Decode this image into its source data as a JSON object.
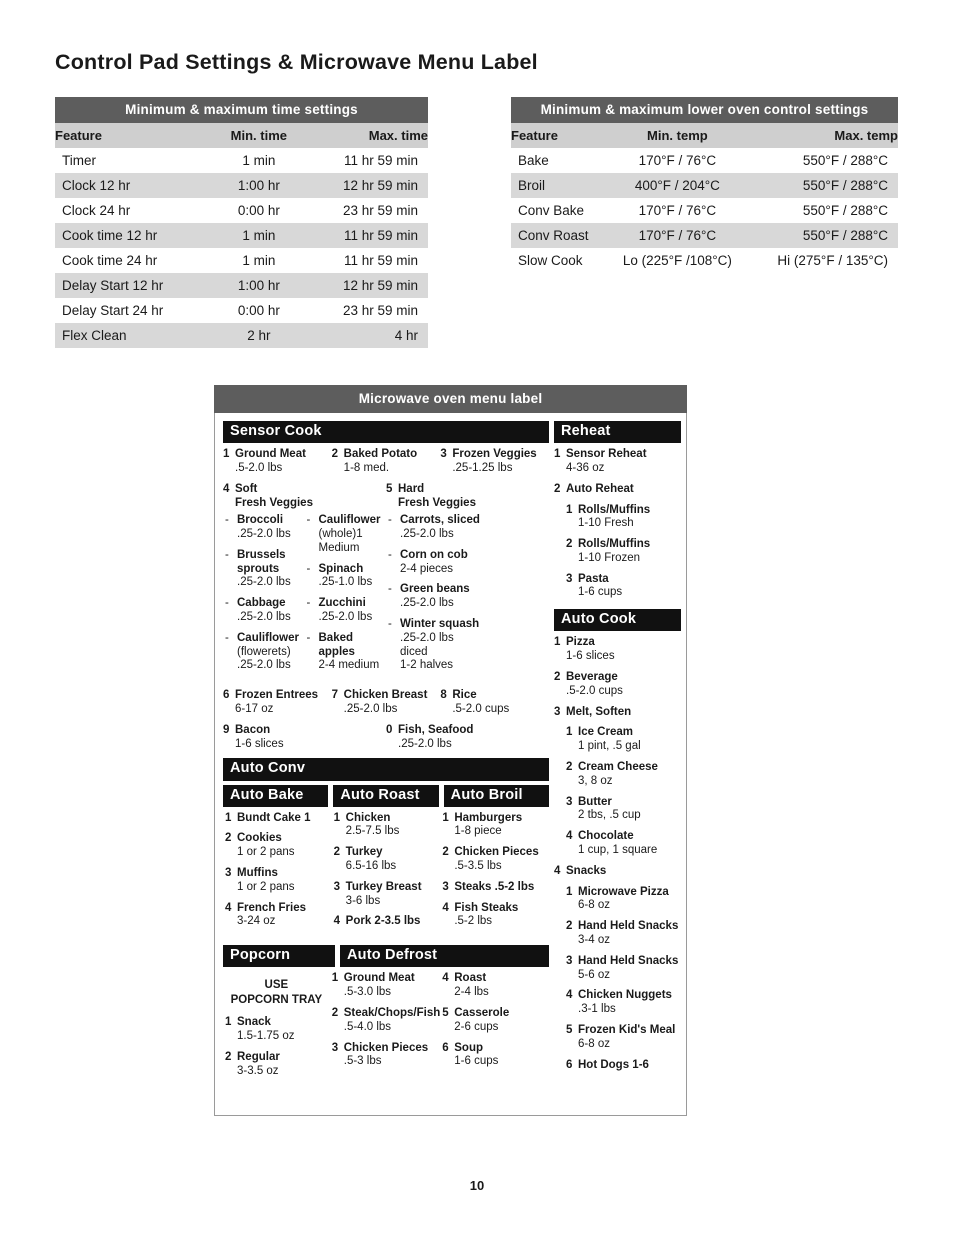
{
  "page_title": "Control Pad Settings & Microwave Menu Label",
  "page_number": "10",
  "time_table": {
    "title": "Minimum & maximum time settings",
    "columns": [
      "Feature",
      "Min. time",
      "Max. time"
    ],
    "rows": [
      [
        "Timer",
        "1 min",
        "11 hr 59 min"
      ],
      [
        "Clock 12 hr",
        "1:00 hr",
        "12 hr 59 min"
      ],
      [
        "Clock 24 hr",
        "0:00 hr",
        "23 hr 59 min"
      ],
      [
        "Cook time 12 hr",
        "1 min",
        "11 hr 59 min"
      ],
      [
        "Cook time 24 hr",
        "1 min",
        "11 hr 59 min"
      ],
      [
        "Delay Start 12 hr",
        "1:00 hr",
        "12 hr 59 min"
      ],
      [
        "Delay Start 24 hr",
        "0:00 hr",
        "23 hr 59 min"
      ],
      [
        "Flex Clean",
        "2 hr",
        "4 hr"
      ]
    ]
  },
  "oven_table": {
    "title": "Minimum & maximum lower oven control settings",
    "columns": [
      "Feature",
      "Min. temp",
      "Max. temp"
    ],
    "rows": [
      [
        "Bake",
        "170°F / 76°C",
        "550°F / 288°C"
      ],
      [
        "Broil",
        "400°F / 204°C",
        "550°F / 288°C"
      ],
      [
        "Conv Bake",
        "170°F / 76°C",
        "550°F / 288°C"
      ],
      [
        "Conv Roast",
        "170°F / 76°C",
        "550°F / 288°C"
      ],
      [
        "Slow Cook",
        "Lo (225°F /108°C)",
        "Hi (275°F / 135°C)"
      ]
    ]
  },
  "menu_label": {
    "title": "Microwave oven menu label",
    "sensor_cook": {
      "bar": "Sensor Cook",
      "row1": [
        {
          "num": "1",
          "name": "Ground Meat",
          "qty": ".5-2.0 lbs"
        },
        {
          "num": "2",
          "name": "Baked Potato",
          "qty": "1-8 med."
        },
        {
          "num": "3",
          "name": "Frozen Veggies",
          "qty": ".25-1.25 lbs"
        }
      ],
      "soft": {
        "num": "4",
        "line1": "Soft",
        "line2": "Fresh Veggies",
        "col1": [
          {
            "name": "Broccoli",
            "qty": ".25-2.0 lbs"
          },
          {
            "name": "Brussels sprouts",
            "qty": ".25-2.0 lbs"
          },
          {
            "name": "Cabbage",
            "qty": ".25-2.0 lbs"
          },
          {
            "name": "Cauliflower",
            "qty": "(flowerets)\n.25-2.0 lbs"
          }
        ],
        "col2": [
          {
            "name": "Cauliflower",
            "qty": "(whole)1 Medium"
          },
          {
            "name": "Spinach",
            "qty": ".25-1.0 lbs"
          },
          {
            "name": "Zucchini",
            "qty": ".25-2.0 lbs"
          },
          {
            "name": "Baked apples",
            "qty": "2-4 medium"
          }
        ]
      },
      "hard": {
        "num": "5",
        "line1": "Hard",
        "line2": "Fresh Veggies",
        "col1": [
          {
            "name": "Carrots, sliced",
            "qty": ".25-2.0 lbs"
          },
          {
            "name": "Corn on cob",
            "qty": "2-4 pieces"
          },
          {
            "name": "Green beans",
            "qty": ".25-2.0 lbs"
          },
          {
            "name": "Winter squash",
            "qty": ".25-2.0 lbs\ndiced\n1-2 halves"
          }
        ]
      },
      "row2": [
        {
          "num": "6",
          "name": "Frozen Entrees",
          "qty": "6-17 oz"
        },
        {
          "num": "7",
          "name": "Chicken Breast",
          "qty": ".25-2.0 lbs"
        },
        {
          "num": "8",
          "name": "Rice",
          "qty": ".5-2.0 cups"
        }
      ],
      "row3": [
        {
          "num": "9",
          "name": "Bacon",
          "qty": "1-6 slices"
        },
        {
          "num": "0",
          "name": "Fish, Seafood",
          "qty": ".25-2.0 lbs"
        }
      ]
    },
    "auto_conv": {
      "bar": "Auto Conv",
      "auto_bake": {
        "bar": "Auto Bake",
        "items": [
          {
            "num": "1",
            "name": "Bundt Cake 1",
            "qty": ""
          },
          {
            "num": "2",
            "name": "Cookies",
            "qty": "1 or 2 pans"
          },
          {
            "num": "3",
            "name": "Muffins",
            "qty": "1 or 2 pans"
          },
          {
            "num": "4",
            "name": "French Fries",
            "qty": "3-24 oz"
          }
        ]
      },
      "auto_roast": {
        "bar": "Auto Roast",
        "items": [
          {
            "num": "1",
            "name": "Chicken",
            "qty": "2.5-7.5 lbs"
          },
          {
            "num": "2",
            "name": "Turkey",
            "qty": "6.5-16 lbs"
          },
          {
            "num": "3",
            "name": "Turkey Breast",
            "qty": "3-6 lbs"
          },
          {
            "num": "4",
            "name": "Pork 2-3.5 lbs",
            "qty": ""
          }
        ]
      },
      "auto_broil": {
        "bar": "Auto Broil",
        "items": [
          {
            "num": "1",
            "name": "Hamburgers",
            "qty": "1-8 piece"
          },
          {
            "num": "2",
            "name": "Chicken Pieces",
            "qty": ".5-3.5 lbs"
          },
          {
            "num": "3",
            "name": "Steaks .5-2 lbs",
            "qty": ""
          },
          {
            "num": "4",
            "name": "Fish Steaks",
            "qty": ".5-2 lbs"
          }
        ]
      }
    },
    "popcorn": {
      "bar": "Popcorn",
      "note": "USE\nPOPCORN TRAY",
      "items": [
        {
          "num": "1",
          "name": "Snack",
          "qty": "1.5-1.75 oz"
        },
        {
          "num": "2",
          "name": "Regular",
          "qty": "3-3.5 oz"
        }
      ]
    },
    "auto_defrost": {
      "bar": "Auto Defrost",
      "col1": [
        {
          "num": "1",
          "name": "Ground Meat",
          "qty": ".5-3.0 lbs"
        },
        {
          "num": "2",
          "name": "Steak/Chops/Fish",
          "qty": ".5-4.0 lbs"
        },
        {
          "num": "3",
          "name": "Chicken Pieces",
          "qty": ".5-3 lbs"
        }
      ],
      "col2": [
        {
          "num": "4",
          "name": "Roast",
          "qty": "2-4 lbs"
        },
        {
          "num": "5",
          "name": "Casserole",
          "qty": "2-6 cups"
        },
        {
          "num": "6",
          "name": "Soup",
          "qty": "1-6 cups"
        }
      ]
    },
    "reheat": {
      "bar": "Reheat",
      "items": [
        {
          "num": "1",
          "name": "Sensor Reheat",
          "qty": "4-36 oz",
          "sub": []
        },
        {
          "num": "2",
          "name": "Auto Reheat",
          "qty": "",
          "sub": [
            {
              "num": "1",
              "name": "Rolls/Muffins",
              "qty": "1-10 Fresh"
            },
            {
              "num": "2",
              "name": "Rolls/Muffins",
              "qty": "1-10 Frozen"
            },
            {
              "num": "3",
              "name": "Pasta",
              "qty": "1-6 cups"
            }
          ]
        }
      ]
    },
    "auto_cook": {
      "bar": "Auto Cook",
      "items": [
        {
          "num": "1",
          "name": "Pizza",
          "qty": "1-6 slices",
          "sub": []
        },
        {
          "num": "2",
          "name": "Beverage",
          "qty": ".5-2.0 cups",
          "sub": []
        },
        {
          "num": "3",
          "name": "Melt, Soften",
          "qty": "",
          "sub": [
            {
              "num": "1",
              "name": "Ice Cream",
              "qty": "1 pint, .5 gal"
            },
            {
              "num": "2",
              "name": "Cream Cheese",
              "qty": "3, 8 oz"
            },
            {
              "num": "3",
              "name": "Butter",
              "qty": "2 tbs, .5 cup"
            },
            {
              "num": "4",
              "name": "Chocolate",
              "qty": "1 cup, 1 square"
            }
          ]
        },
        {
          "num": "4",
          "name": "Snacks",
          "qty": "",
          "sub": [
            {
              "num": "1",
              "name": "Microwave Pizza",
              "qty": "6-8 oz"
            },
            {
              "num": "2",
              "name": "Hand Held Snacks",
              "qty": "3-4 oz"
            },
            {
              "num": "3",
              "name": "Hand Held Snacks",
              "qty": "5-6 oz"
            },
            {
              "num": "4",
              "name": "Chicken Nuggets",
              "qty": ".3-1 lbs"
            },
            {
              "num": "5",
              "name": "Frozen Kid's Meal",
              "qty": "6-8 oz"
            },
            {
              "num": "6",
              "name": "Hot Dogs 1-6",
              "qty": ""
            }
          ]
        }
      ]
    }
  }
}
